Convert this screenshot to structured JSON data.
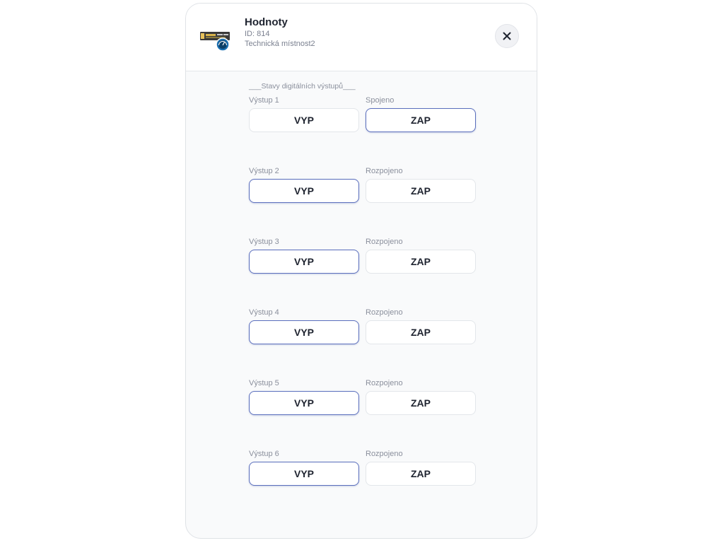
{
  "header": {
    "title": "Hodnoty",
    "id_line": "ID: 814",
    "room_line": "Technická místnost2",
    "device_icon": "device-module-gauge-icon",
    "close_icon": "close-icon"
  },
  "section": {
    "title": "___Stavy digitálních výstupů___"
  },
  "outputs": [
    {
      "name": "Výstup 1",
      "state": "Spojeno",
      "off_label": "VYP",
      "on_label": "ZAP",
      "active": "on"
    },
    {
      "name": "Výstup 2",
      "state": "Rozpojeno",
      "off_label": "VYP",
      "on_label": "ZAP",
      "active": "off"
    },
    {
      "name": "Výstup 3",
      "state": "Rozpojeno",
      "off_label": "VYP",
      "on_label": "ZAP",
      "active": "off"
    },
    {
      "name": "Výstup 4",
      "state": "Rozpojeno",
      "off_label": "VYP",
      "on_label": "ZAP",
      "active": "off"
    },
    {
      "name": "Výstup 5",
      "state": "Rozpojeno",
      "off_label": "VYP",
      "on_label": "ZAP",
      "active": "off"
    },
    {
      "name": "Výstup 6",
      "state": "Rozpojeno",
      "off_label": "VYP",
      "on_label": "ZAP",
      "active": "off"
    }
  ],
  "colors": {
    "active_border": "#5b6fbd",
    "text_primary": "#1f2430",
    "text_muted": "#8a8f9c",
    "panel_background": "#f9fafb"
  }
}
